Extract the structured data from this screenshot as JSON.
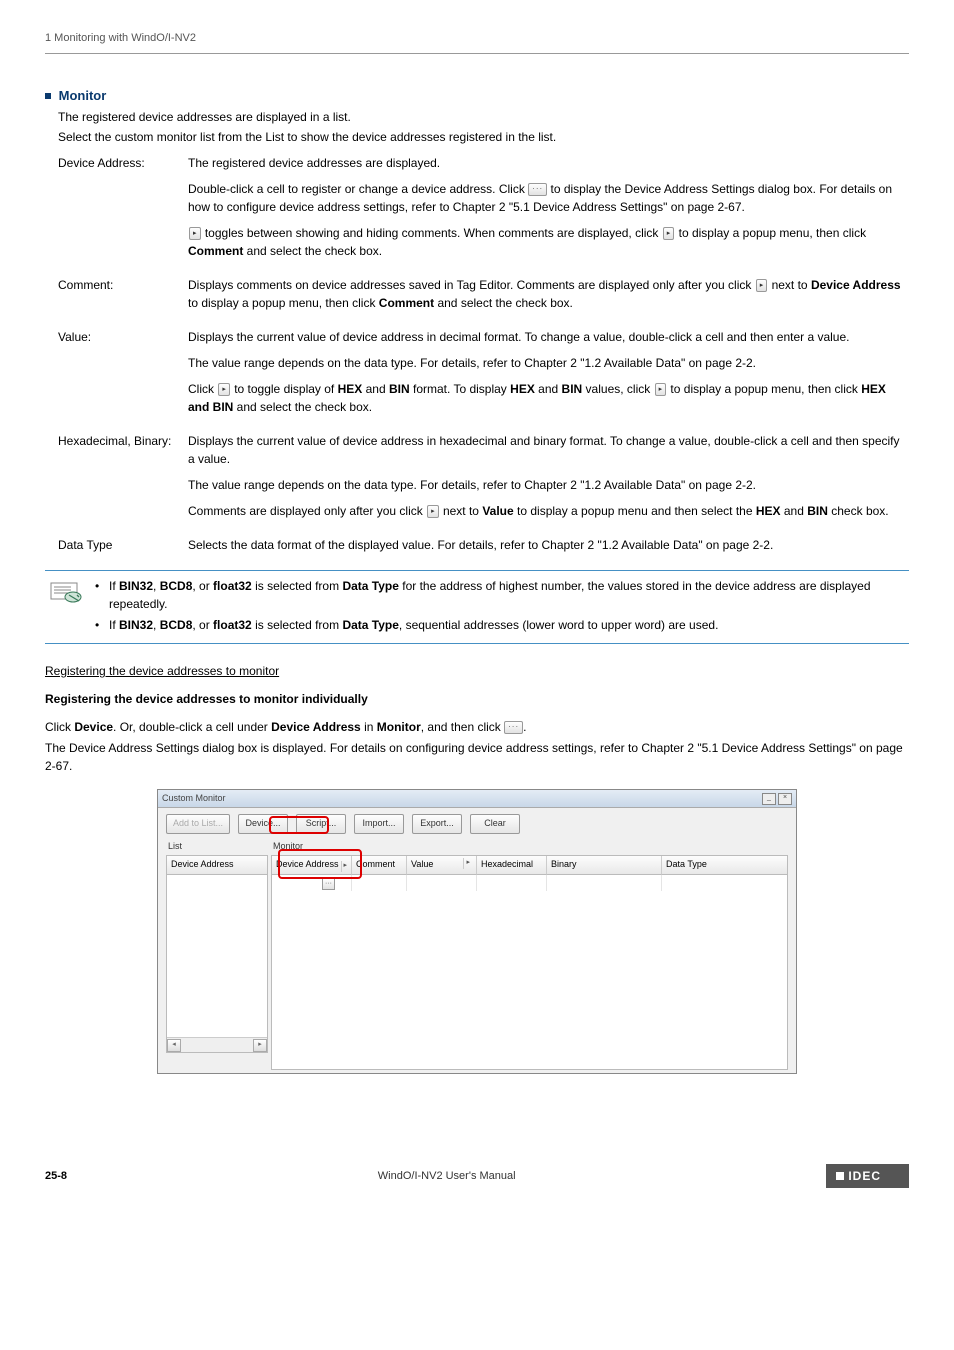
{
  "header": {
    "breadcrumb": "1 Monitoring with WindO/I-NV2"
  },
  "monitor": {
    "heading": "Monitor",
    "intro1": "The registered device addresses are displayed in a list.",
    "intro2": "Select the custom monitor list from the List to show the device addresses registered in the list.",
    "rows": [
      {
        "label": "Device Address:",
        "paras": [
          "The registered device addresses are displayed.",
          "Double-click a cell to register or change a device address. Click [ELLIPSIS] to display the Device Address Settings dialog box. For details on how to configure device address settings, refer to Chapter 2 \"5.1 Device Address Settings\" on page 2-67.",
          "[ARROW] toggles between showing and hiding comments. When comments are displayed, click [ARROW] to display a popup menu, then click [B]Comment[/B] and select the check box."
        ]
      },
      {
        "label": "Comment:",
        "paras": [
          "Displays comments on device addresses saved in Tag Editor. Comments are displayed only after you click [ARROW] next to [B]Device Address[/B] to display a popup menu, then click [B]Comment[/B] and select the check box."
        ]
      },
      {
        "label": "Value:",
        "paras": [
          "Displays the current value of device address in decimal format. To change a value, double-click a cell and then enter a value.",
          "The value range depends on the data type. For details, refer to Chapter 2 \"1.2 Available Data\" on page 2-2.",
          "Click [ARROW] to toggle display of [B]HEX[/B] and [B]BIN[/B] format. To display [B]HEX[/B] and [B]BIN[/B] values, click [ARROW] to display a popup menu, then click [B]HEX and BIN[/B] and select the check box."
        ]
      },
      {
        "label": "Hexadecimal, Binary:",
        "paras": [
          "Displays the current value of device address in hexadecimal and binary format. To change a value, double-click a cell and then specify a value.",
          "The value range depends on the data type. For details, refer to Chapter 2 \"1.2 Available Data\" on page 2-2.",
          "Comments are displayed only after you click [ARROW] next to [B]Value[/B] to display a popup menu and then select the [B]HEX[/B] and [B]BIN[/B] check box."
        ]
      },
      {
        "label": "Data Type",
        "paras": [
          "Selects the data format of the displayed value. For details, refer to Chapter 2 \"1.2 Available Data\" on page 2-2."
        ]
      }
    ],
    "notes": [
      "If [B]BIN32[/B], [B]BCD8[/B], or [B]float32[/B] is selected from [B]Data Type[/B] for the address of highest number, the values stored in the device address are displayed repeatedly.",
      "If [B]BIN32[/B], [B]BCD8[/B], or [B]float32[/B] is selected from [B]Data Type[/B], sequential addresses (lower word to upper word) are used."
    ]
  },
  "registering": {
    "underlined": "Registering the device addresses to monitor",
    "bold": "Registering the device addresses to monitor individually",
    "para1": "Click [B]Device[/B]. Or, double-click a cell under [B]Device Address[/B] in [B]Monitor[/B], and then click [ELLIPSIS].",
    "para2": "The Device Address Settings dialog box is displayed. For details on configuring device address settings, refer to Chapter 2 \"5.1 Device Address Settings\" on page 2-67."
  },
  "screenshot": {
    "title": "Custom Monitor",
    "buttons": {
      "add_to_list": "Add to List...",
      "device": "Device...",
      "script": "Script...",
      "import": "Import...",
      "export": "Export...",
      "clear": "Clear"
    },
    "list_label": "List",
    "monitor_label": "Monitor",
    "list_header": "Device Address",
    "columns": {
      "device_address": "Device Address",
      "comment": "Comment",
      "value": "Value",
      "hexadecimal": "Hexadecimal",
      "binary": "Binary",
      "data_type": "Data Type"
    }
  },
  "footer": {
    "page": "25-8",
    "center": "WindO/I-NV2 User's Manual",
    "logo": "IDEC"
  }
}
